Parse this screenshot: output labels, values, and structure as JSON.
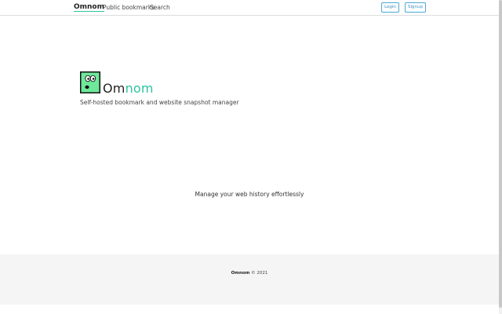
{
  "navbar": {
    "brand": "Omnom",
    "links": [
      "Public bookmarks",
      "Search"
    ],
    "login_label": "Login",
    "signup_label": "Signup"
  },
  "hero": {
    "title_part1": "Om",
    "title_part2": "nom",
    "subtitle": "Self-hosted bookmark and website snapshot manager",
    "logo_icon": "omnom-face-logo-icon"
  },
  "tagline": "Manage your web history effortlessly",
  "footer": {
    "brand": "Omnom",
    "copyright": "© 2021"
  },
  "colors": {
    "accent": "#2ec4a0",
    "logo_bg": "#6ee89a",
    "button_border": "#4aa8d8",
    "footer_bg": "#f5f5f5"
  }
}
